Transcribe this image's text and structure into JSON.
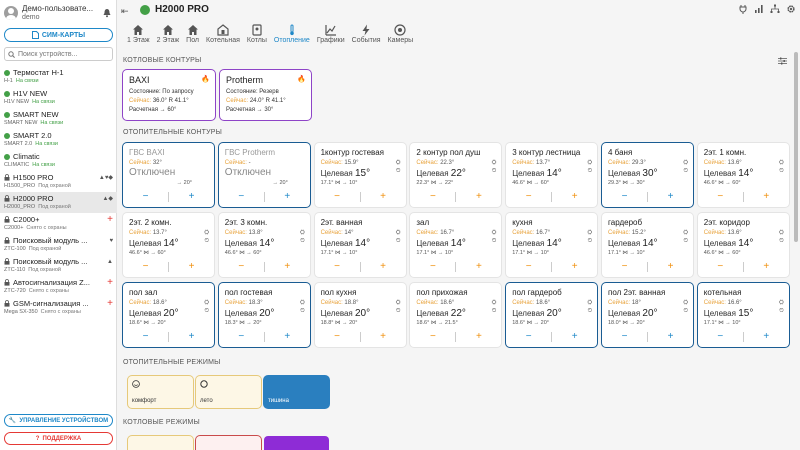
{
  "user": {
    "name": "Демо-пользовате...",
    "login": "demo"
  },
  "sidebar": {
    "sim_label": "СИМ-КАРТЫ",
    "search_placeholder": "Поиск устройств...",
    "devices": [
      {
        "name": "Термостат Н-1",
        "model": "H-1",
        "status": "На связи",
        "icon": "online-dot"
      },
      {
        "name": "H1V NEW",
        "model": "H1V NEW",
        "status": "На связи",
        "icon": "online-dot"
      },
      {
        "name": "SMART NEW",
        "model": "SMART NEW",
        "status": "На связи",
        "icon": "online-dot"
      },
      {
        "name": "SMART 2.0",
        "model": "SMART 2.0",
        "status": "На связи",
        "icon": "online-dot"
      },
      {
        "name": "Climatic",
        "model": "CLIMATIC",
        "status": "На связи",
        "icon": "online-dot"
      },
      {
        "name": "H1500 PRO",
        "model": "H1500_PRO",
        "status": "Под охраной",
        "icon": "lock-icon"
      },
      {
        "name": "H2000 PRO",
        "model": "H2000_PRO",
        "status": "Под охраной",
        "icon": "lock-icon"
      },
      {
        "name": "C2000+",
        "model": "C2000+",
        "status": "Снято с охраны",
        "icon": "lock-icon"
      },
      {
        "name": "Поисковый модуль ...",
        "model": "ZTC-100",
        "status": "Под охраной",
        "icon": "lock-icon"
      },
      {
        "name": "Поисковый модуль ...",
        "model": "ZTC-110",
        "status": "Под охраной",
        "icon": "lock-icon"
      },
      {
        "name": "Автосигнализация Z...",
        "model": "ZTC-720",
        "status": "Снято с охраны",
        "icon": "lock-icon"
      },
      {
        "name": "GSM-сигнализация ...",
        "model": "Mega SX-350",
        "status": "Снято с охраны",
        "icon": "lock-icon"
      }
    ],
    "manage_label": "УПРАВЛЕНИЕ УСТРОЙСТВОМ",
    "support_label": "ПОДДЕРЖКА"
  },
  "header": {
    "title": "H2000 PRO",
    "tabs": [
      "1 Этаж",
      "2 Этаж",
      "Пол",
      "Котельная",
      "Котлы",
      "Отопление",
      "Графики",
      "События",
      "Камеры"
    ],
    "active_tab": "Отопление"
  },
  "sections": {
    "boilers": "КОТЛОВЫЕ КОНТУРЫ",
    "heating": "ОТОПИТЕЛЬНЫЕ КОНТУРЫ",
    "heat_modes": "ОТОПИТЕЛЬНЫЕ РЕЖИМЫ",
    "boiler_modes": "КОТЛОВЫЕ РЕЖИМЫ"
  },
  "boilers": [
    {
      "name": "BAXI",
      "state": "Состояние: По запросу",
      "now": "Сейчас:",
      "data": "36.0° R 41.1°",
      "calc": "Расчетная → 60°"
    },
    {
      "name": "Protherm",
      "state": "Состояние: Резерв",
      "now": "Сейчас:",
      "data": "24.0° R 41.1°",
      "calc": "Расчетная → 30°"
    }
  ],
  "labels": {
    "now": "Сейчас:",
    "target": "Целевая",
    "off": "Отключен"
  },
  "circuits": [
    {
      "name": "ГВС BAXI",
      "now": "32°",
      "off": true,
      "meta": "→ 20°"
    },
    {
      "name": "ГВС Protherm",
      "now": "-",
      "off": true,
      "meta": "→ 20°"
    },
    {
      "name": "1контур гостевая",
      "now": "15.9°",
      "target": "15°",
      "meta": "17.1° ⋈ → 10°"
    },
    {
      "name": "2 контур пол душ",
      "now": "22.3°",
      "target": "22°",
      "meta": "22.3° ⋈ → 22°"
    },
    {
      "name": "3 контур лестница",
      "now": "13.7°",
      "target": "14°",
      "meta": "46.6° ⋈ → 60°"
    },
    {
      "name": "4 баня",
      "now": "29.3°",
      "target": "30°",
      "meta": "29.3° ⋈ → 30°"
    },
    {
      "name": "2эт. 1 комн.",
      "now": "13.6°",
      "target": "14°",
      "meta": "46.6° ⋈ → 60°"
    },
    {
      "name": "2эт. 2 комн.",
      "now": "13.7°",
      "target": "14°",
      "meta": "46.6° ⋈ → 60°"
    },
    {
      "name": "2эт. 3 комн.",
      "now": "13.8°",
      "target": "14°",
      "meta": "46.6° ⋈ → 60°"
    },
    {
      "name": "2эт. ванная",
      "now": "14°",
      "target": "14°",
      "meta": "17.1° ⋈ → 10°"
    },
    {
      "name": "зал",
      "now": "16.7°",
      "target": "14°",
      "meta": "17.1° ⋈ → 10°"
    },
    {
      "name": "кухня",
      "now": "16.7°",
      "target": "14°",
      "meta": "17.1° ⋈ → 10°"
    },
    {
      "name": "гардероб",
      "now": "15.2°",
      "target": "14°",
      "meta": "17.1° ⋈ → 10°"
    },
    {
      "name": "2эт. коридор",
      "now": "13.6°",
      "target": "14°",
      "meta": "46.6° ⋈ → 60°"
    },
    {
      "name": "пол зал",
      "now": "18.6°",
      "target": "20°",
      "meta": "18.6° ⋈ → 20°"
    },
    {
      "name": "пол гостевая",
      "now": "18.3°",
      "target": "20°",
      "meta": "18.3° ⋈ → 20°"
    },
    {
      "name": "пол кухня",
      "now": "18.8°",
      "target": "20°",
      "meta": "18.8° ⋈ → 20°"
    },
    {
      "name": "пол прихожая",
      "now": "18.6°",
      "target": "22°",
      "meta": "18.6° ⋈ → 21.5°"
    },
    {
      "name": "пол гардероб",
      "now": "18.6°",
      "target": "20°",
      "meta": "18.6° ⋈ → 20°"
    },
    {
      "name": "пол 2эт. ванная",
      "now": "18°",
      "target": "20°",
      "meta": "18.0° ⋈ → 20°"
    },
    {
      "name": "котельная",
      "now": "16.6°",
      "target": "15°",
      "meta": "17.1° ⋈ → 10°"
    }
  ],
  "heat_modes": [
    {
      "name": "комфорт",
      "bg": "#fdf7e6",
      "border": "#e6c97a"
    },
    {
      "name": "лето",
      "bg": "#fdf7e6",
      "border": "#e6c97a"
    },
    {
      "name": "тишина",
      "bg": "#2a7fbf",
      "border": "#2a7fbf"
    }
  ],
  "colors": {
    "accent": "#1e88c8",
    "online": "#43a047",
    "hot_border": "#1a5c93",
    "boiler_border": "#8e44c7",
    "now_label": "#e8a33c",
    "control_orange": "#f0900e"
  }
}
